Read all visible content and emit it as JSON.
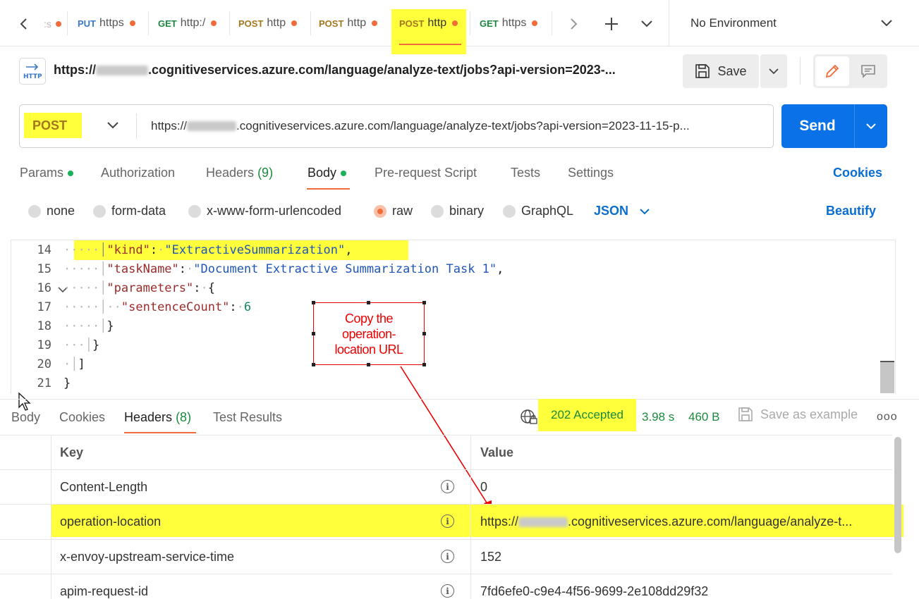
{
  "tabs": [
    {
      "method": "PUT",
      "url": "https",
      "color": "#3a78c9"
    },
    {
      "method": "GET",
      "url": "http:/",
      "color": "#1c8a3e"
    },
    {
      "method": "POST",
      "url": "http",
      "color": "#a5761c"
    },
    {
      "method": "POST",
      "url": "http",
      "color": "#a5761c"
    },
    {
      "method": "POST",
      "url": "http",
      "color": "#a5761c"
    },
    {
      "method": "GET",
      "url": "https",
      "color": "#1c8a3e"
    }
  ],
  "environment": "No Environment",
  "request": {
    "icon_label": "HTTP",
    "title_prefix": "https://",
    "title_suffix": ".cognitiveservices.azure.com/language/analyze-text/jobs?api-version=2023-...",
    "save_label": "Save"
  },
  "urlbar": {
    "method": "POST",
    "url_prefix": "https://",
    "url_suffix": ".cognitiveservices.azure.com/language/analyze-text/jobs?api-version=2023-11-15-p...",
    "send_label": "Send"
  },
  "request_tabs": {
    "params": "Params",
    "authorization": "Authorization",
    "headers": "Headers",
    "headers_count": "(9)",
    "body": "Body",
    "prerequest": "Pre-request Script",
    "tests": "Tests",
    "settings": "Settings",
    "cookies": "Cookies"
  },
  "body_types": {
    "none": "none",
    "form_data": "form-data",
    "urlencoded": "x-www-form-urlencoded",
    "raw": "raw",
    "binary": "binary",
    "graphql": "GraphQL",
    "format": "JSON",
    "beautify": "Beautify"
  },
  "editor": {
    "lines": [
      {
        "n": "14",
        "key": "\"kind\"",
        "val": "\"ExtractiveSummarization\""
      },
      {
        "n": "15",
        "key": "\"taskName\"",
        "val": "\"Document Extractive Summarization Task 1\""
      },
      {
        "n": "16",
        "key": "\"parameters\"",
        "val": "{"
      },
      {
        "n": "17",
        "key": "\"sentenceCount\"",
        "val": "6"
      },
      {
        "n": "18",
        "text": "}"
      },
      {
        "n": "19",
        "text": "}"
      },
      {
        "n": "20",
        "text": "]"
      },
      {
        "n": "21",
        "text": "}"
      }
    ]
  },
  "callout": {
    "line1": "Copy the",
    "line2": "operation-",
    "line3": "location URL"
  },
  "response": {
    "tabs": {
      "body": "Body",
      "cookies": "Cookies",
      "headers": "Headers",
      "headers_count": "(8)",
      "tests": "Test Results"
    },
    "status": "202 Accepted",
    "time": "3.98 s",
    "size": "460 B",
    "save_example": "Save as example",
    "more": "ooo"
  },
  "headers_table": {
    "col_key": "Key",
    "col_value": "Value",
    "rows": [
      {
        "key": "Content-Length",
        "value": "0"
      },
      {
        "key": "operation-location",
        "value_prefix": "https://",
        "value_suffix": ".cognitiveservices.azure.com/language/analyze-t..."
      },
      {
        "key": "x-envoy-upstream-service-time",
        "value": "152"
      },
      {
        "key": "apim-request-id",
        "value": "7fd6efe0-c9e4-4f56-9699-2e108dd29f32"
      }
    ]
  },
  "colors": {
    "accent": "#0a72e6",
    "highlight": "#ffff3c",
    "tab_underline": "#f26b3a",
    "status_green": "#1c8a3e",
    "annotation": "#e00000"
  }
}
